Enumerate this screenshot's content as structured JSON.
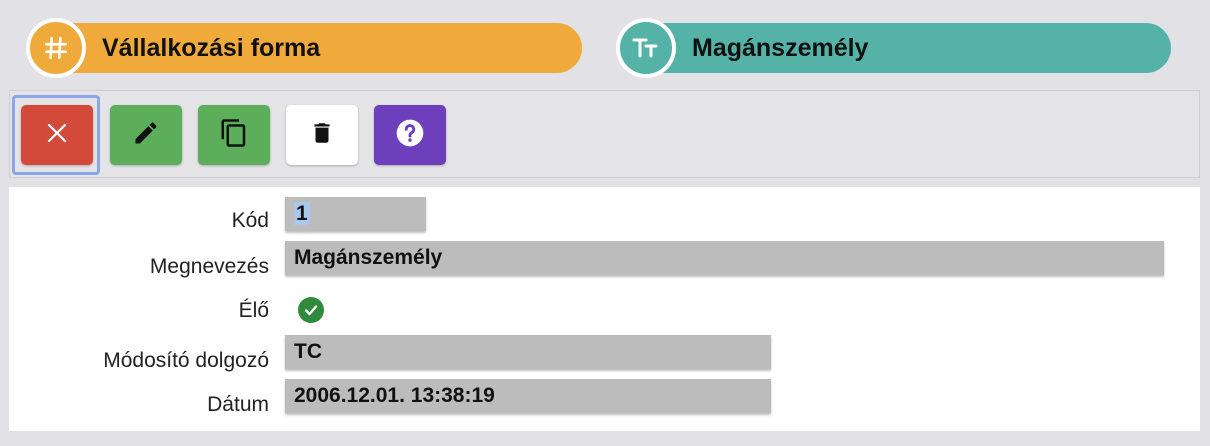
{
  "header": {
    "pill_left": {
      "label": "Vállalkozási forma",
      "icon": "hash-icon",
      "color": "#f0aa3c"
    },
    "pill_right": {
      "label": "Magánszemély",
      "icon": "text-type-icon",
      "color": "#54b2a7"
    }
  },
  "toolbar": {
    "buttons": [
      {
        "name": "close",
        "icon": "close-icon",
        "color": "#d44a3a"
      },
      {
        "name": "edit",
        "icon": "pencil-icon",
        "color": "#5cae5a"
      },
      {
        "name": "copy",
        "icon": "copy-icon",
        "color": "#5cae5a"
      },
      {
        "name": "delete",
        "icon": "trash-icon",
        "color": "#ffffff"
      },
      {
        "name": "help",
        "icon": "help-icon",
        "color": "#6d3fbd"
      }
    ]
  },
  "form": {
    "kod": {
      "label": "Kód",
      "value": "1"
    },
    "megnevezes": {
      "label": "Megnevezés",
      "value": "Magánszemély"
    },
    "elo": {
      "label": "Élő",
      "checked": true,
      "icon": "check-circle-icon",
      "color": "#2f8a3b"
    },
    "modosito": {
      "label": "Módosító dolgozó",
      "value": "TC"
    },
    "datum": {
      "label": "Dátum",
      "value": "2006.12.01. 13:38:19"
    }
  }
}
